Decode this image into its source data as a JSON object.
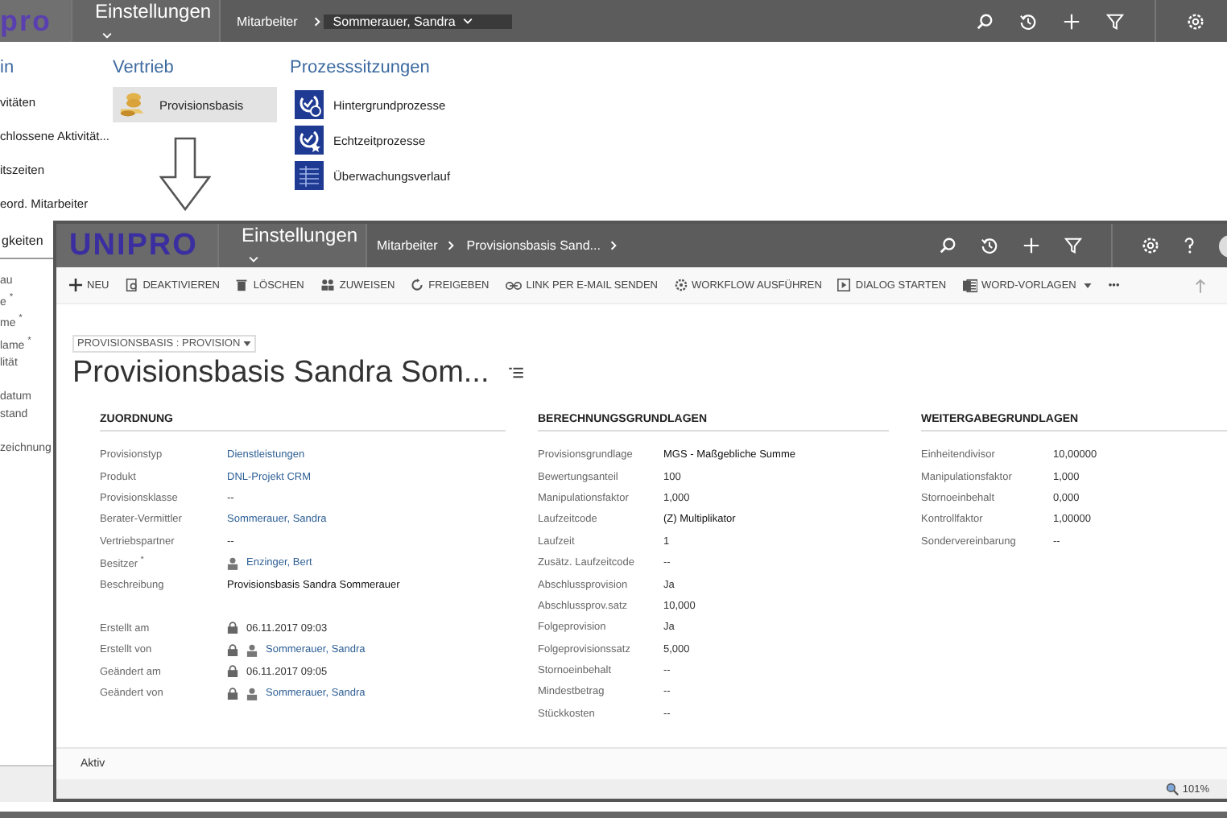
{
  "back_window": {
    "logo": "pro",
    "area": "Einstellungen",
    "breadcrumb": [
      {
        "label": "Mitarbeiter",
        "selected": false
      },
      {
        "label": "Sommerauer, Sandra",
        "selected": true
      }
    ],
    "menu_groups": [
      {
        "title": "in",
        "items": [
          {
            "label": "vitäten",
            "kind": "text",
            "selected": false
          },
          {
            "label": "chlossene Aktivität...",
            "kind": "text",
            "selected": false
          },
          {
            "label": "itszeiten",
            "kind": "text",
            "selected": false
          },
          {
            "label": "eord. Mitarbeiter",
            "kind": "text",
            "selected": false
          }
        ]
      },
      {
        "title": "Vertrieb",
        "items": [
          {
            "label": "Provisionsbasis",
            "kind": "coins",
            "selected": true
          }
        ]
      },
      {
        "title": "Prozesssitzungen",
        "items": [
          {
            "label": "Hintergrundprozesse",
            "kind": "clock",
            "selected": false
          },
          {
            "label": "Echtzeitprozesse",
            "kind": "star",
            "selected": false
          },
          {
            "label": "Überwachungsverlauf",
            "kind": "grid",
            "selected": false
          }
        ]
      }
    ],
    "left_tab": "gkeiten",
    "left_labels": [
      [
        "au",
        "e $^{*}$",
        "me $^{*}$",
        "lame $^{*}$",
        "lität"
      ],
      [
        "datum",
        "stand"
      ],
      [
        "zeichnung"
      ]
    ]
  },
  "front_window": {
    "logo": "UNIPRO",
    "area": "Einstellungen",
    "breadcrumb": [
      "Mitarbeiter",
      "Provisionsbasis Sand..."
    ],
    "commands": [
      {
        "label": "NEU",
        "kind": "plus"
      },
      {
        "label": "DEAKTIVIEREN",
        "kind": "doc"
      },
      {
        "label": "LÖSCHEN",
        "kind": "trash"
      },
      {
        "label": "ZUWEISEN",
        "kind": "people"
      },
      {
        "label": "FREIGEBEN",
        "kind": "share"
      },
      {
        "label": "LINK PER E-MAIL SENDEN",
        "kind": "link"
      },
      {
        "label": "WORKFLOW AUSFÜHREN",
        "kind": "gear"
      },
      {
        "label": "DIALOG STARTEN",
        "kind": "play"
      },
      {
        "label": "WORD-VORLAGEN",
        "kind": "word"
      },
      {
        "label": "•••",
        "kind": "more"
      }
    ],
    "form_selector": "PROVISIONSBASIS : PROVISION",
    "title": "Provisionsbasis Sandra Som...",
    "sections": [
      {
        "heading": "ZUORDNUNG",
        "groups": [
          [
            {
              "label": "Provisionstyp",
              "value": "Dienstleistungen",
              "kind": "link"
            },
            {
              "label": "Produkt",
              "value": "DNL-Projekt CRM",
              "kind": "link"
            },
            {
              "label": "Provisionsklasse",
              "value": "--",
              "kind": "text"
            },
            {
              "label": "Berater-Vermittler",
              "value": "Sommerauer, Sandra",
              "kind": "link"
            },
            {
              "label": "Vertriebspartner",
              "value": "--",
              "kind": "text"
            },
            {
              "label": "Besitzer $^{*}$",
              "value": "Enzinger, Bert",
              "kind": "user"
            },
            {
              "label": "Beschreibung",
              "value": "Provisionsbasis Sandra Sommerauer",
              "kind": "strong"
            }
          ],
          [
            {
              "label": "Erstellt am",
              "value": "06.11.2017  09:03",
              "kind": "locked"
            },
            {
              "label": "Erstellt von",
              "value": "Sommerauer, Sandra",
              "kind": "locked_user"
            },
            {
              "label": "Geändert am",
              "value": "06.11.2017  09:05",
              "kind": "locked"
            },
            {
              "label": "Geändert von",
              "value": "Sommerauer, Sandra",
              "kind": "locked_user"
            }
          ]
        ]
      },
      {
        "heading": "BERECHNUNGSGRUNDLAGEN",
        "groups": [
          [
            {
              "label": "Provisionsgrundlage",
              "value": "MGS - Maßgebliche Summe",
              "kind": "strong"
            },
            {
              "label": "Bewertungsanteil",
              "value": "100",
              "kind": "text"
            },
            {
              "label": "Manipulationsfaktor",
              "value": "1,000",
              "kind": "text"
            },
            {
              "label": "Laufzeitcode",
              "value": "(Z) Multiplikator",
              "kind": "strong"
            },
            {
              "label": "Laufzeit",
              "value": "1",
              "kind": "text"
            },
            {
              "label": "Zusätz. Laufzeitcode",
              "value": "--",
              "kind": "text"
            },
            {
              "label": "Abschlussprovision",
              "value": "Ja",
              "kind": "text"
            },
            {
              "label": "Abschlussprov.satz",
              "value": "10,000",
              "kind": "text"
            },
            {
              "label": "Folgeprovision",
              "value": "Ja",
              "kind": "text"
            },
            {
              "label": "Folgeprovisionssatz",
              "value": "5,000",
              "kind": "text"
            },
            {
              "label": "Stornoeinbehalt",
              "value": "--",
              "kind": "text"
            },
            {
              "label": "Mindestbetrag",
              "value": "--",
              "kind": "text"
            },
            {
              "label": "Stückkosten",
              "value": "--",
              "kind": "text"
            }
          ]
        ]
      },
      {
        "heading": "WEITERGABEGRUNDLAGEN",
        "groups": [
          [
            {
              "label": "Einheitendivisor",
              "value": "10,00000",
              "kind": "text"
            },
            {
              "label": "Manipulationsfaktor",
              "value": "1,000",
              "kind": "text"
            },
            {
              "label": "Stornoeinbehalt",
              "value": "0,000",
              "kind": "text"
            },
            {
              "label": "Kontrollfaktor",
              "value": "1,00000",
              "kind": "text"
            },
            {
              "label": "Sondervereinbarung",
              "value": "--",
              "kind": "text"
            }
          ]
        ]
      }
    ],
    "status": "Aktiv",
    "zoom": "101%"
  }
}
